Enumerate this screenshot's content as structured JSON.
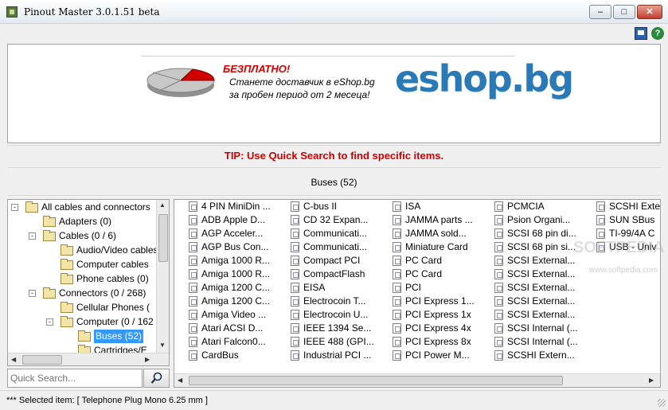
{
  "window": {
    "title": "Pinout Master 3.0.1.51 beta",
    "min_label": "–",
    "max_label": "□",
    "close_label": "✕"
  },
  "toolbar": {
    "help_label": "?"
  },
  "ad": {
    "free": "БЕЗПЛАТНО!",
    "line1": "Станете доставчик в eShop.bg",
    "line2": "за пробен период от 2 месеца!",
    "logo": "eshop.bg",
    "colors": {
      "accent_red": "#d00000",
      "logo_blue": "#2a7ab8"
    }
  },
  "tip": "TIP: Use Quick Search to find specific items.",
  "section_title": "Buses (52)",
  "tree": {
    "items": [
      {
        "label": "All cables and connectors",
        "level": 0,
        "expander": "-"
      },
      {
        "label": "Adapters (0)",
        "level": 1,
        "expander": ""
      },
      {
        "label": "Cables (0 / 6)",
        "level": 1,
        "expander": "-"
      },
      {
        "label": "Audio/Video cables",
        "level": 2,
        "expander": ""
      },
      {
        "label": "Computer cables",
        "level": 2,
        "expander": ""
      },
      {
        "label": "Phone cables (0)",
        "level": 2,
        "expander": ""
      },
      {
        "label": "Connectors (0 / 268)",
        "level": 1,
        "expander": "-"
      },
      {
        "label": "Cellular Phones (",
        "level": 2,
        "expander": ""
      },
      {
        "label": "Computer (0 / 162",
        "level": 2,
        "expander": "-"
      },
      {
        "label": "Buses (52)",
        "level": 3,
        "expander": "",
        "selected": true
      },
      {
        "label": "Cartridges/E",
        "level": 3,
        "expander": ""
      }
    ]
  },
  "search": {
    "placeholder": "Quick Search..."
  },
  "list": {
    "columns": [
      [
        "4 PIN MiniDin ...",
        "ADB Apple D...",
        "AGP Acceler...",
        "AGP Bus Con...",
        "Amiga 1000 R...",
        "Amiga 1000 R...",
        "Amiga 1200 C...",
        "Amiga 1200 C...",
        "Amiga Video ...",
        "Atari ACSI D...",
        "Atari Falcon0...",
        "CardBus"
      ],
      [
        "C-bus II",
        "CD 32 Expan...",
        "Communicati...",
        "Communicati...",
        "Compact PCI",
        "CompactFlash",
        "EISA",
        "Electrocoin T...",
        "Electrocoin U...",
        "IEEE 1394 Se...",
        "IEEE 488 (GPI...",
        "Industrial PCI ..."
      ],
      [
        "ISA",
        "JAMMA parts ...",
        "JAMMA sold...",
        "Miniature Card",
        "PC Card",
        "PC Card",
        "PCI",
        "PCI Express 1...",
        "PCI Express 1x",
        "PCI Express 4x",
        "PCI Express 8x",
        "PCI Power M..."
      ],
      [
        "PCMCIA",
        "Psion Organi...",
        "SCSI 68 pin di...",
        "SCSI 68 pin si...",
        "SCSI External...",
        "SCSI External...",
        "SCSI External...",
        "SCSI External...",
        "SCSI External...",
        "SCSI Internal (...",
        "SCSI Internal (...",
        "SCSHI Extern..."
      ],
      [
        "SCSHI Exte",
        "SUN SBus",
        "TI-99/4A C",
        "USB - Univ"
      ]
    ]
  },
  "watermark": {
    "text": "SOFTPEDIA",
    "sub": "www.softpedia.com"
  },
  "status": "*** Selected item: [ Telephone Plug Mono 6.25 mm ]"
}
